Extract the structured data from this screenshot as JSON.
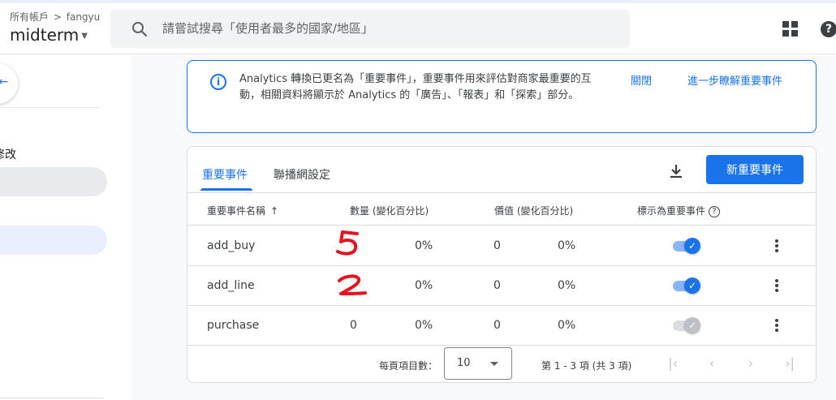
{
  "header": {
    "breadcrumb_root": "所有帳戶",
    "breadcrumb_sep": ">",
    "account": "fangyu",
    "property": "midterm",
    "search_placeholder": "請嘗試搜尋「使用者最多的國家/地區」",
    "help_label": "?"
  },
  "sidebar": {
    "partial_text": "修改"
  },
  "banner": {
    "info_icon": "i",
    "message": "Analytics 轉換已更名為「重要事件」，重要事件用來評估對商家最重要的互動，相關資料將顯示於 Analytics 的「廣告」、「報表」和「探索」部分。",
    "dismiss": "關閉",
    "learn_more": "進一步瞭解重要事件"
  },
  "tabs": [
    {
      "label": "重要事件",
      "active": true
    },
    {
      "label": "聯播網設定",
      "active": false
    }
  ],
  "actions": {
    "new_button": "新重要事件"
  },
  "table": {
    "columns": {
      "name": "重要事件名稱",
      "sort_arrow": "↑",
      "count": "數量 (變化百分比)",
      "value": "價值 (變化百分比)",
      "mark": "標示為重要事件",
      "mark_help": "?"
    },
    "rows": [
      {
        "name": "add_buy",
        "count": "",
        "count_pct": "0%",
        "value": "0",
        "value_pct": "0%",
        "marked": true,
        "check": "✓"
      },
      {
        "name": "add_line",
        "count": "",
        "count_pct": "0%",
        "value": "0",
        "value_pct": "0%",
        "marked": true,
        "check": "✓"
      },
      {
        "name": "purchase",
        "count": "0",
        "count_pct": "0%",
        "value": "0",
        "value_pct": "0%",
        "marked": false,
        "check": "✓"
      }
    ],
    "handwritten_annotations": [
      "5",
      "2"
    ]
  },
  "footer": {
    "rows_per_page_label": "每頁項目數：",
    "rows_per_page": "10",
    "range": "第 1 - 3 項 (共 3 項)",
    "first_page": "|‹",
    "prev_page": "‹",
    "next_page": "›",
    "last_page": "›|"
  },
  "colors": {
    "accent": "#1a73e8",
    "annotation": "#e8121f"
  }
}
